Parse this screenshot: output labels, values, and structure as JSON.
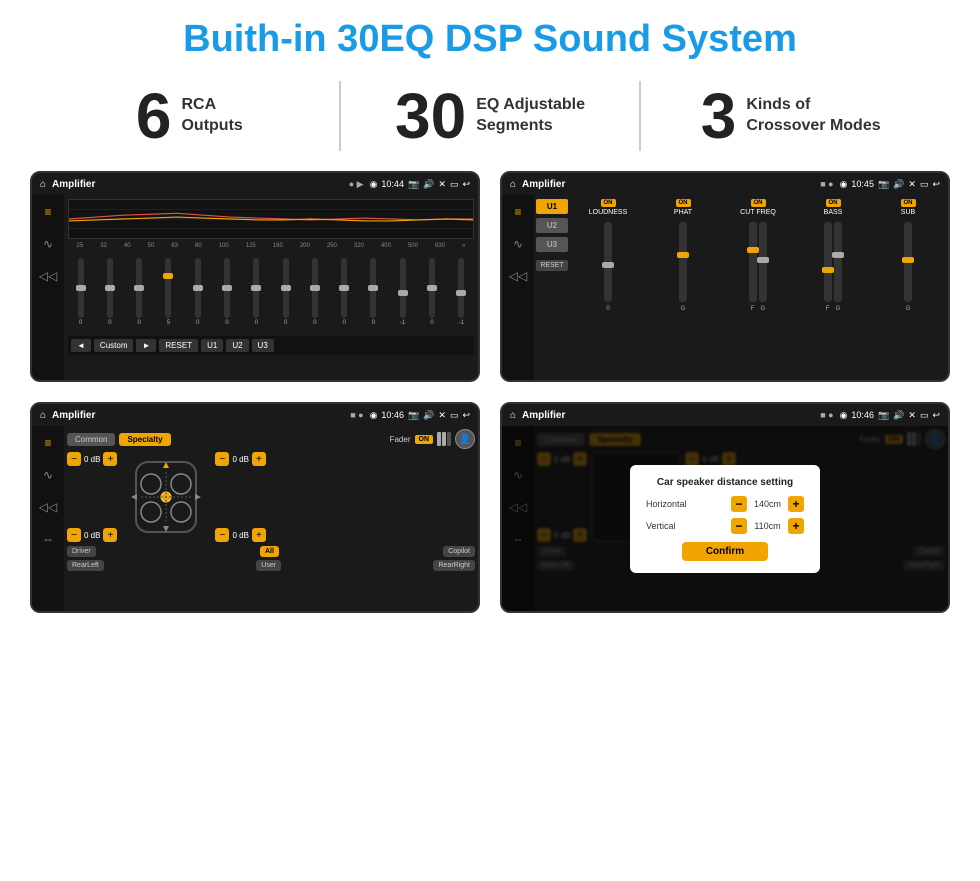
{
  "header": {
    "title": "Buith-in 30EQ DSP Sound System"
  },
  "stats": [
    {
      "number": "6",
      "label": "RCA\nOutputs"
    },
    {
      "number": "30",
      "label": "EQ Adjustable\nSegments"
    },
    {
      "number": "3",
      "label": "Kinds of\nCrossover Modes"
    }
  ],
  "screens": {
    "eq": {
      "status_bar": {
        "title": "Amplifier",
        "time": "10:44"
      },
      "eq_values": [
        "0",
        "0",
        "0",
        "5",
        "0",
        "0",
        "0",
        "0",
        "0",
        "0",
        "0",
        "-1",
        "0",
        "-1"
      ],
      "eq_freqs": [
        "25",
        "32",
        "40",
        "50",
        "63",
        "80",
        "100",
        "125",
        "160",
        "200",
        "250",
        "320",
        "400",
        "500",
        "630"
      ],
      "buttons": [
        "◄",
        "Custom",
        "►",
        "RESET",
        "U1",
        "U2",
        "U3"
      ]
    },
    "crossover": {
      "status_bar": {
        "title": "Amplifier",
        "time": "10:45"
      },
      "presets": [
        "U1",
        "U2",
        "U3"
      ],
      "controls": [
        {
          "label": "LOUDNESS",
          "on": true
        },
        {
          "label": "PHAT",
          "on": true
        },
        {
          "label": "CUT FREQ",
          "on": true
        },
        {
          "label": "BASS",
          "on": true
        },
        {
          "label": "SUB",
          "on": true
        }
      ],
      "reset_label": "RESET"
    },
    "fader": {
      "status_bar": {
        "title": "Amplifier",
        "time": "10:46"
      },
      "tabs": [
        "Common",
        "Specialty"
      ],
      "fader_label": "Fader",
      "fader_on": "ON",
      "positions": [
        {
          "label": "Driver",
          "value": "0 dB"
        },
        {
          "label": "RearLeft",
          "value": "0 dB"
        },
        {
          "label": "Copilot",
          "value": "0 dB"
        },
        {
          "label": "RearRight",
          "value": "0 dB"
        }
      ],
      "all_label": "All",
      "user_label": "User"
    },
    "dialog": {
      "status_bar": {
        "title": "Amplifier",
        "time": "10:46"
      },
      "tabs": [
        "Common",
        "Specialty"
      ],
      "dialog_title": "Car speaker distance setting",
      "horizontal_label": "Horizontal",
      "horizontal_value": "140cm",
      "vertical_label": "Vertical",
      "vertical_value": "110cm",
      "confirm_label": "Confirm",
      "positions": [
        {
          "label": "Driver",
          "value": "0 dB"
        },
        {
          "label": "RearLeft",
          "value": "0 dB"
        },
        {
          "label": "Copilot",
          "value": "0 dB"
        },
        {
          "label": "RearRight",
          "value": "0 dB"
        }
      ],
      "all_label": "All",
      "user_label": "User"
    }
  },
  "icons": {
    "home": "⌂",
    "location": "◉",
    "speaker": "♪",
    "arrow_back": "↩",
    "eq": "≡",
    "wave": "∿",
    "volume": "◁",
    "expand": "⇔",
    "minus": "−",
    "plus": "+"
  }
}
